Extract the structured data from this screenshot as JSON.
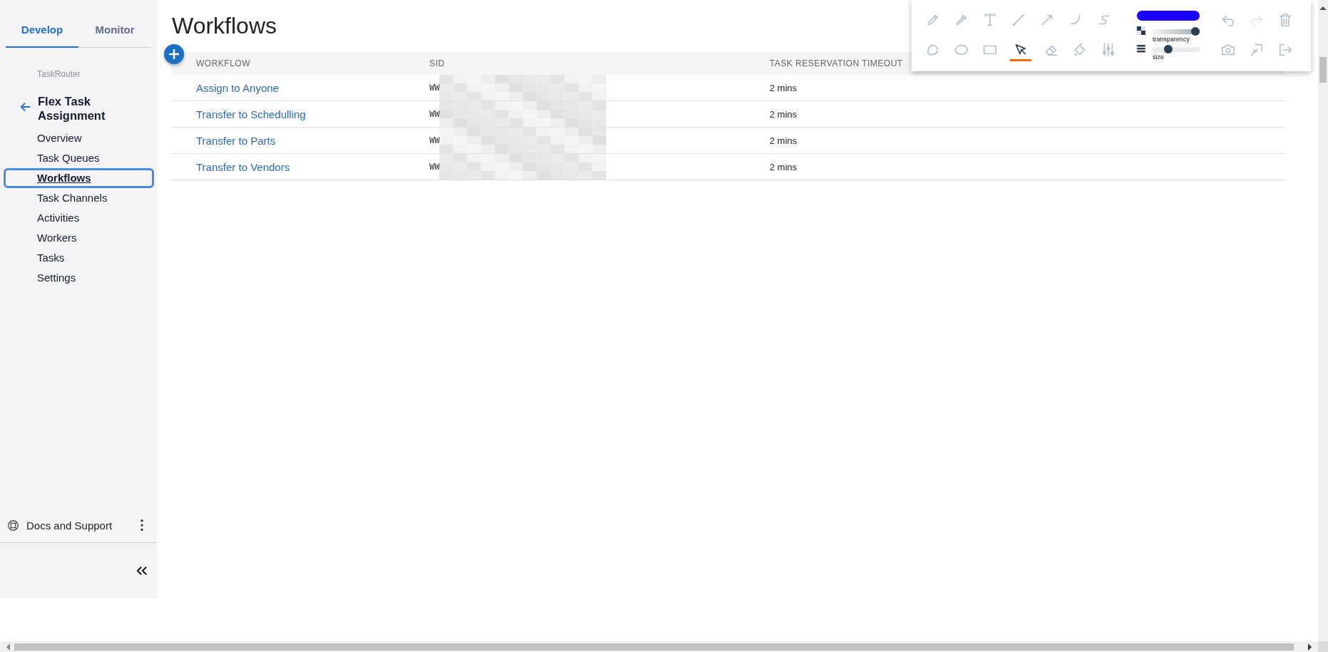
{
  "sidebar": {
    "tabs": [
      {
        "label": "Develop",
        "selected": true
      },
      {
        "label": "Monitor",
        "selected": false
      }
    ],
    "breadcrumb": "TaskRouter",
    "title": "Flex Task Assignment",
    "items": [
      {
        "label": "Overview",
        "selected": false
      },
      {
        "label": "Task Queues",
        "selected": false
      },
      {
        "label": "Workflows",
        "selected": true
      },
      {
        "label": "Task Channels",
        "selected": false
      },
      {
        "label": "Activities",
        "selected": false
      },
      {
        "label": "Workers",
        "selected": false
      },
      {
        "label": "Tasks",
        "selected": false
      },
      {
        "label": "Settings",
        "selected": false
      }
    ],
    "footer": {
      "label": "Docs and Support"
    }
  },
  "page": {
    "title": "Workflows"
  },
  "table": {
    "columns": [
      "WORKFLOW",
      "SID",
      "TASK RESERVATION TIMEOUT"
    ],
    "rows": [
      {
        "workflow": "Assign to Anyone",
        "sid": "WW",
        "timeout": "2 mins"
      },
      {
        "workflow": "Transfer to Schedulling",
        "sid": "WW",
        "timeout": "2 mins"
      },
      {
        "workflow": "Transfer to Parts",
        "sid": "WW",
        "timeout": "2 mins"
      },
      {
        "workflow": "Transfer to Vendors",
        "sid": "WW",
        "timeout": "2 mins"
      }
    ]
  },
  "annotation_toolbar": {
    "tools": [
      {
        "kind": "pencil",
        "selected": false
      },
      {
        "kind": "dropper",
        "selected": false
      },
      {
        "kind": "text",
        "selected": false
      },
      {
        "kind": "line",
        "selected": false
      },
      {
        "kind": "arrow",
        "selected": false
      },
      {
        "kind": "curve",
        "selected": false
      },
      {
        "kind": "squiggle",
        "selected": false
      },
      {
        "kind": "blob",
        "selected": false
      },
      {
        "kind": "ellipse",
        "selected": false
      },
      {
        "kind": "rectangle",
        "selected": false
      },
      {
        "kind": "cursor",
        "selected": true
      },
      {
        "kind": "eraser",
        "selected": false
      },
      {
        "kind": "fill",
        "selected": false
      },
      {
        "kind": "sliders",
        "selected": false
      }
    ],
    "color": "#1a00ff",
    "transparency": {
      "label": "transparency",
      "level": 1.0
    },
    "size": {
      "label": "size",
      "level": 0.3
    },
    "actions": [
      {
        "kind": "undo",
        "disabled": false
      },
      {
        "kind": "redo",
        "disabled": true
      },
      {
        "kind": "trash",
        "disabled": false
      },
      {
        "kind": "camera",
        "disabled": false
      },
      {
        "kind": "resize",
        "disabled": false
      },
      {
        "kind": "exit",
        "disabled": false
      }
    ]
  }
}
